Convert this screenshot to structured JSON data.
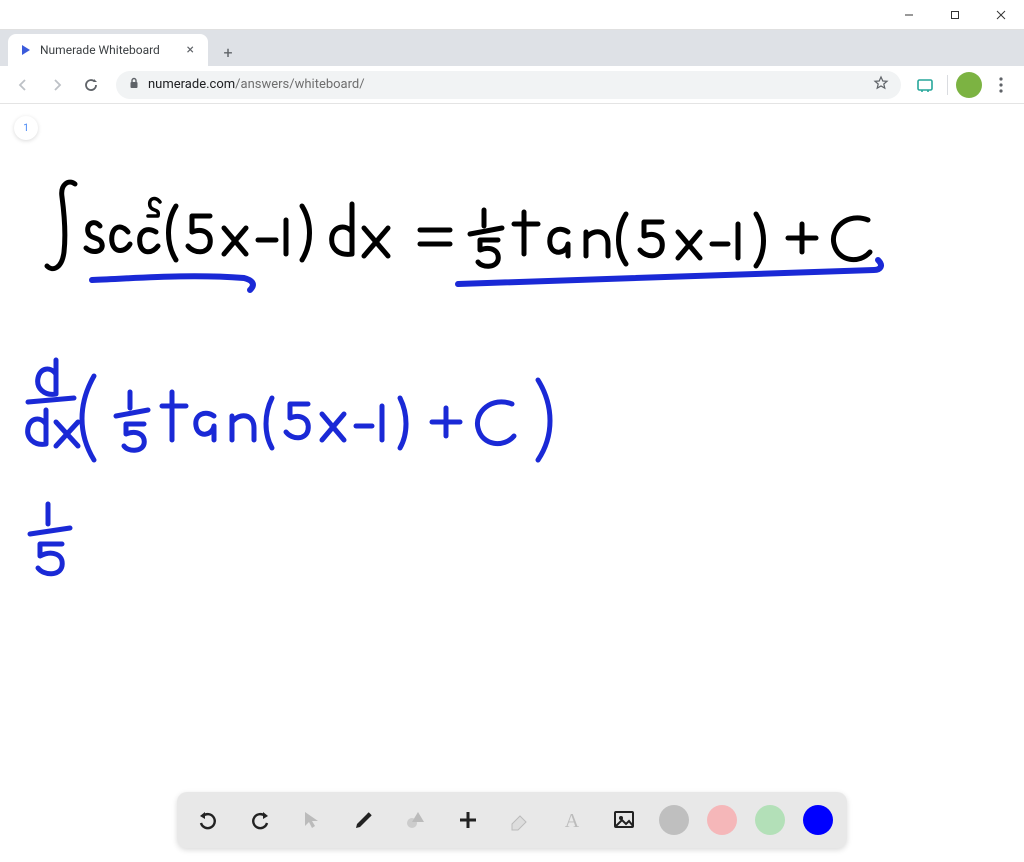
{
  "window": {
    "minimize": "—",
    "maximize": "☐",
    "close": "✕"
  },
  "browser": {
    "tab_title": "Numerade Whiteboard",
    "new_tab": "+",
    "url_domain": "numerade.com",
    "url_path": "/answers/whiteboard/"
  },
  "whiteboard": {
    "page_number": "1",
    "equations": {
      "line1_lhs": "∫ sec²(5x − 1) dx",
      "line1_rhs": "= 1/5 tan(5x − 1) + C",
      "line2": "d/dx ( 1/5 tan(5x − 1) + C )",
      "line3": "1/5"
    },
    "colors": {
      "ink_black": "#000000",
      "ink_blue": "#1a29d6",
      "underline_blue": "#1a29d6"
    }
  },
  "toolbar": {
    "tools": {
      "undo": "undo",
      "redo": "redo",
      "pointer": "pointer",
      "pen": "pen",
      "shapes": "shapes",
      "insert": "insert",
      "eraser": "eraser",
      "text": "text",
      "image": "image"
    },
    "colors": {
      "gray": "#bfbfbf",
      "pink": "#f5b7b9",
      "green": "#b3e0b8",
      "blue": "#0000ff"
    },
    "selected_color": "blue"
  }
}
